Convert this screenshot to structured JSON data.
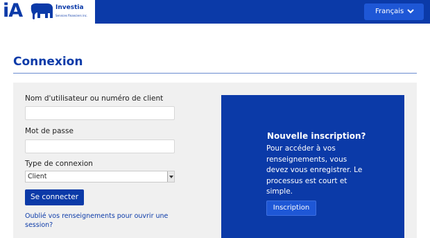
{
  "header": {
    "logo": {
      "mark": "iA",
      "brand": "Investia",
      "tagline": "Services financiers inc."
    },
    "language_button": {
      "label": "Français",
      "icon": "chevron-down-icon"
    }
  },
  "main": {
    "title": "Connexion"
  },
  "login_form": {
    "username_label": "Nom d'utilisateur ou numéro de client",
    "username_value": "",
    "password_label": "Mot de passe",
    "password_value": "",
    "connection_type_label": "Type de connexion",
    "connection_type_selected": "Client",
    "submit_label": "Se connecter",
    "forgot_link": "Oublié vos renseignements pour ouvrir une session?"
  },
  "signup_panel": {
    "title": "Nouvelle inscription?",
    "text": "Pour accéder à vos renseignements, vous devez vous enregistrer. Le processus est court et simple.",
    "button_label": "Inscription"
  },
  "colors": {
    "brand_blue": "#0b3aa8",
    "accent_blue": "#1e57d6",
    "panel_bg": "#f0f0f0"
  }
}
